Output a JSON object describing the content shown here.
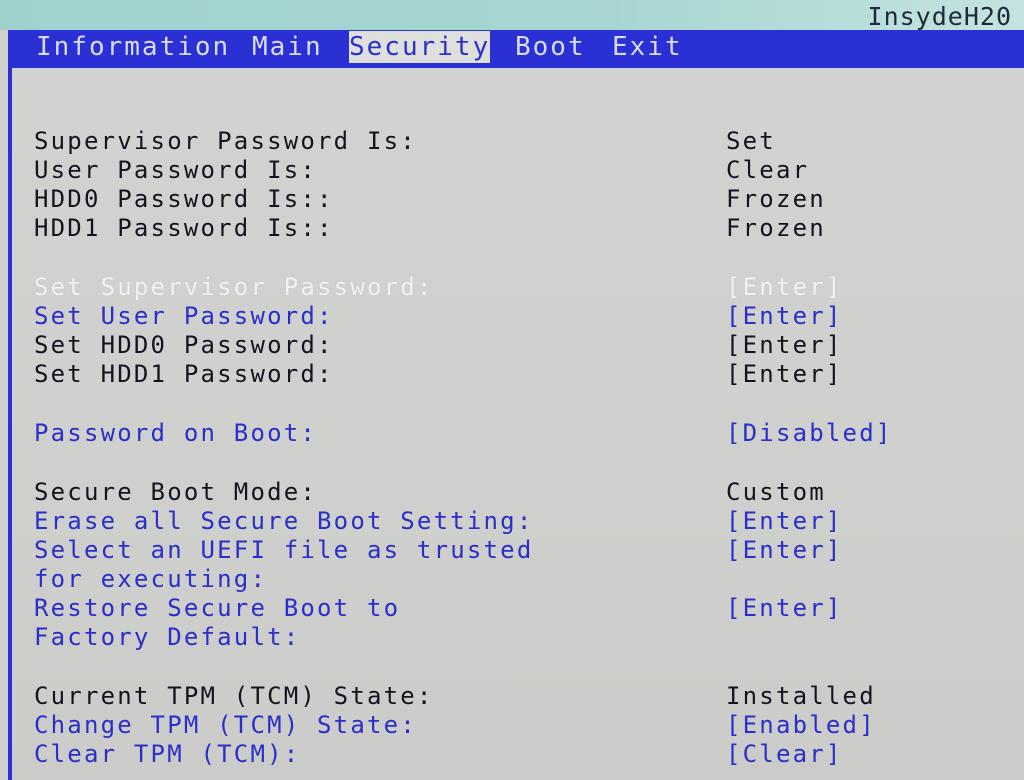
{
  "brand": "InsydeH20",
  "menu": {
    "tabs": [
      "Information",
      "Main",
      "Security",
      "Boot",
      "Exit"
    ],
    "active": "Security"
  },
  "rows": [
    {
      "label": "Supervisor Password Is:",
      "value": "Set"
    },
    {
      "label": "User Password Is:",
      "value": "Clear"
    },
    {
      "label": "HDD0 Password Is::",
      "value": "Frozen"
    },
    {
      "label": "HDD1 Password Is::",
      "value": "Frozen"
    },
    {
      "label": "Set Supervisor Password:",
      "value": "[Enter]"
    },
    {
      "label": "Set User Password:",
      "value": "[Enter]"
    },
    {
      "label": "Set HDD0 Password:",
      "value": "[Enter]"
    },
    {
      "label": "Set HDD1 Password:",
      "value": "[Enter]"
    },
    {
      "label": "Password on Boot:",
      "value": "[Disabled]"
    },
    {
      "label": "Secure Boot Mode:",
      "value": "Custom"
    },
    {
      "label": "Erase all Secure Boot Setting:",
      "value": "[Enter]"
    },
    {
      "label": "Select an UEFI file as trusted",
      "value": "[Enter]"
    },
    {
      "label": "for executing:",
      "value": ""
    },
    {
      "label": "Restore Secure Boot to",
      "value": "[Enter]"
    },
    {
      "label": "Factory Default:",
      "value": ""
    },
    {
      "label": "Current TPM (TCM) State:",
      "value": "Installed"
    },
    {
      "label": "Change TPM (TCM) State:",
      "value": "[Enabled]"
    },
    {
      "label": "Clear TPM (TCM):",
      "value": "[Clear]"
    }
  ],
  "colors": {
    "menu_bar": "#2b30d4",
    "panel": "#cfd0ce",
    "selectable_text": "#2a2fc8",
    "static_text": "#141420",
    "highlight_text": "#f2f2f4"
  }
}
